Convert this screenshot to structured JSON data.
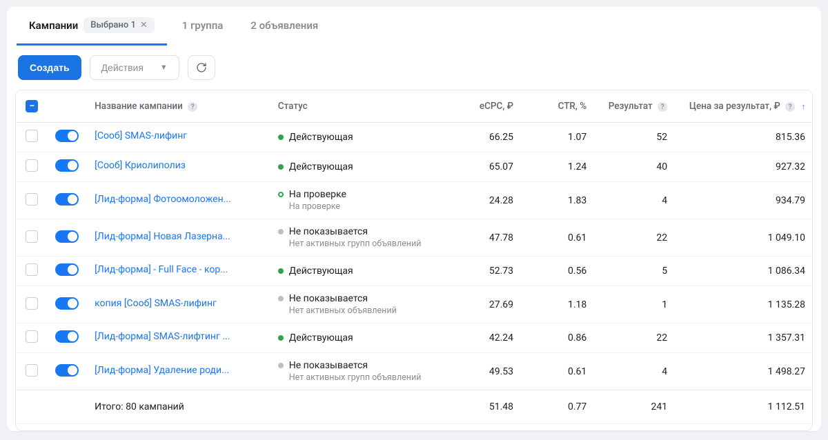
{
  "tabs": {
    "campaigns": "Кампании",
    "selected_chip": "Выбрано 1",
    "group": "1 группа",
    "ads": "2 объявления"
  },
  "toolbar": {
    "create": "Создать",
    "actions": "Действия"
  },
  "columns": {
    "name": "Название кампании",
    "status": "Статус",
    "ecpc": "eCPC, ₽",
    "ctr": "CTR, %",
    "result": "Результат",
    "price": "Цена за результат, ₽"
  },
  "status_labels": {
    "active": "Действующая",
    "review": "На проверке",
    "review_sub": "На проверке",
    "not_shown": "Не показывается",
    "no_groups": "Нет активных групп объявлений",
    "no_ads": "Нет активных объявлений"
  },
  "rows": [
    {
      "name": "[Сооб] SMAS-лифинг",
      "status": "active",
      "sub": "",
      "ecpc": "66.25",
      "ctr": "1.07",
      "result": "52",
      "price": "815.36"
    },
    {
      "name": "[Сооб] Криолиполиз",
      "status": "active",
      "sub": "",
      "ecpc": "65.07",
      "ctr": "1.24",
      "result": "40",
      "price": "927.32"
    },
    {
      "name": "[Лид-форма] Фотоомоложен...",
      "status": "review",
      "sub": "review_sub",
      "ecpc": "24.28",
      "ctr": "1.83",
      "result": "4",
      "price": "934.79"
    },
    {
      "name": "[Лид-форма] Новая Лазерна...",
      "status": "not_shown",
      "sub": "no_groups",
      "ecpc": "47.78",
      "ctr": "0.61",
      "result": "22",
      "price": "1 049.10"
    },
    {
      "name": "[Лид-форма] - Full Face - кор...",
      "status": "active",
      "sub": "",
      "ecpc": "52.73",
      "ctr": "0.56",
      "result": "5",
      "price": "1 086.34"
    },
    {
      "name": "копия [Сооб] SMAS-лифинг",
      "status": "not_shown",
      "sub": "no_ads",
      "ecpc": "27.69",
      "ctr": "1.18",
      "result": "1",
      "price": "1 135.28"
    },
    {
      "name": "[Лид-форма] SMAS-лифтинг ...",
      "status": "active",
      "sub": "",
      "ecpc": "42.24",
      "ctr": "0.86",
      "result": "22",
      "price": "1 357.31"
    },
    {
      "name": "[Лид-форма] Удаление роди...",
      "status": "not_shown",
      "sub": "no_groups",
      "ecpc": "49.53",
      "ctr": "0.61",
      "result": "4",
      "price": "1 498.27"
    }
  ],
  "totals": {
    "label": "Итого: 80 кампаний",
    "ecpc": "51.48",
    "ctr": "0.77",
    "result": "241",
    "price": "1 112.51"
  }
}
